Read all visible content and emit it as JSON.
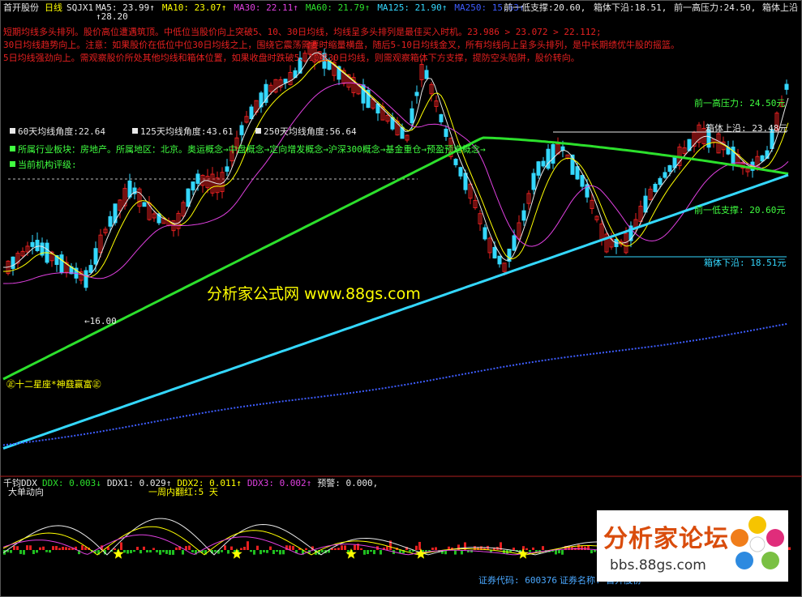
{
  "header": {
    "title": "首开股份",
    "period": "日线",
    "indicator": "SQJX1",
    "ma": [
      {
        "label": "MA5:",
        "value": "23.99↑",
        "color": "#e8e8e8"
      },
      {
        "label": "MA10:",
        "value": "23.07↑",
        "color": "#ffff00"
      },
      {
        "label": "MA30:",
        "value": "22.11↑",
        "color": "#e040e0"
      },
      {
        "label": "MA60:",
        "value": "21.79↑",
        "color": "#2ce02c"
      },
      {
        "label": "MA125:",
        "value": "21.90↑",
        "color": "#34d8ff"
      },
      {
        "label": "MA250:",
        "value": "15.63↑",
        "color": "#3e5dff"
      }
    ],
    "support_label": "前一低支撑:",
    "support_value": "20.60,",
    "box_low_label": "箱体下沿:",
    "box_low_value": "18.51,",
    "resistance_label": "前一高压力:",
    "resistance_value": "24.50,",
    "box_high_label": "箱体上沿"
  },
  "analysis": [
    "短期均线多头排列。股价高位遭遇筑顶。中低位当股价向上突破5、10、30日均线，均线呈多头排列是最佳买入时机。23.986 > 23.072 > 22.112;",
    "30日均线趋势向上。注意：如果股价在低位中位30日均线之上，围绕它震荡需要时缩量横盘，随后5-10日均线金叉，所有均线向上呈多头排列，是中长期绩优牛股的摇篮。",
    "5日均线强劲向上。需观察股价所处其他均线和箱体位置，如果收盘时跌破5、10或30日均线，则需观察箱体下方支撑，提防空头陷阱，股价转向。"
  ],
  "angles": [
    {
      "label": "60天均线角度:",
      "value": "22.64"
    },
    {
      "label": "125天均线角度:",
      "value": "43.61"
    },
    {
      "label": "250天均线角度:",
      "value": "56.64"
    }
  ],
  "industry": "所属行业板块：房地产。所属地区：北京。奥运概念→中盘概念→定向增发概念→沪深300概念→基金重仓→预盈预增概念→",
  "rating": "当前机构评级:",
  "price_marks": {
    "high": "↑28.20",
    "low": "←16.00"
  },
  "levels": {
    "resistance": "前一高压力: 24.50元",
    "box_high": "箱体上沿: 23.48元",
    "support": "前一低支撑: 20.60元",
    "box_low": "箱体下沿: 18.51元"
  },
  "badge": "㊣十二星座*神鼗赢富㊣",
  "watermark": "分析家公式网 www.88gs.com",
  "sub": {
    "name": "千钧DDX",
    "values": [
      {
        "label": "DDX:",
        "value": "0.003↓",
        "color": "#2ce02c"
      },
      {
        "label": "DDX1:",
        "value": "0.029↑",
        "color": "#e8e8e8"
      },
      {
        "label": "DDX2:",
        "value": "0.011↑",
        "color": "#ffff00"
      },
      {
        "label": "DDX3:",
        "value": "0.002↑",
        "color": "#e040e0"
      },
      {
        "label": "预警:",
        "value": "0.000,",
        "color": "#e8e8e8"
      }
    ],
    "title": "大单动向",
    "note": "一周内翻红:5 天"
  },
  "footer": {
    "code_label": "证券代码:",
    "code": "600376",
    "name_label": "证券名称:",
    "name": "首开股份"
  },
  "forum": {
    "title": "分析家论坛",
    "url": "bbs.88gs.com"
  },
  "colors": {
    "up": "#e62020",
    "down": "#34d8ff",
    "ma5": "#e8e8e8",
    "ma10": "#ffff00",
    "ma30": "#e040e0",
    "ma60": "#2ce02c",
    "ma125": "#34d8ff",
    "ma250": "#3e5dff"
  }
}
